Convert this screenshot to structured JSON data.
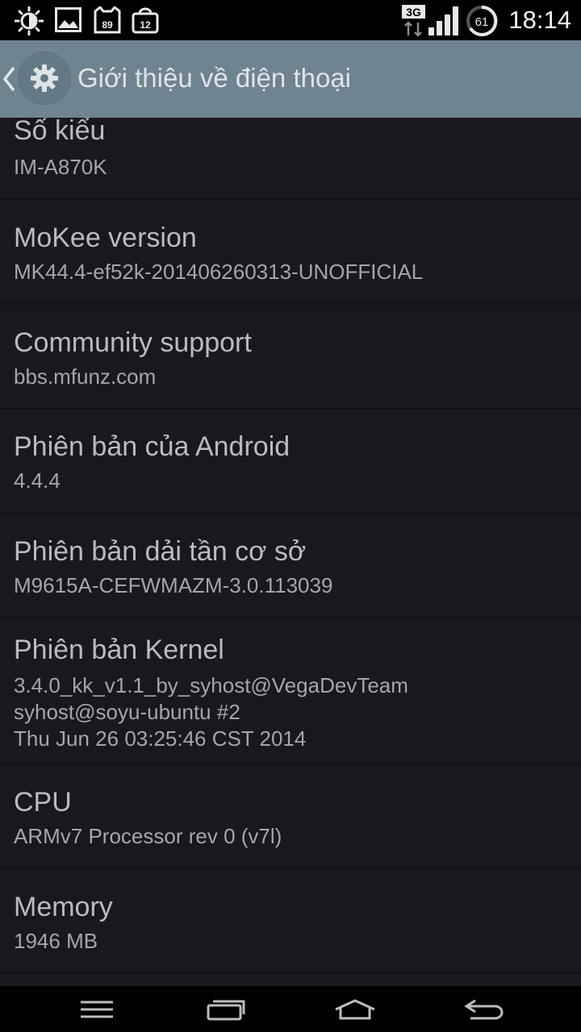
{
  "status_bar": {
    "time": "18:14",
    "network_type": "3G",
    "battery_level": "61",
    "notification_badges": [
      "89",
      "12"
    ],
    "icons": [
      "brightness-icon",
      "gallery-icon",
      "cat-badge-icon",
      "shop-bag-icon",
      "network-3g-icon",
      "signal-icon",
      "battery-icon"
    ]
  },
  "action_bar": {
    "title": "Giới thiệu về điện thoại",
    "back_icon": "chevron-left-icon",
    "app_icon": "gear-icon"
  },
  "items": [
    {
      "title": "Số kiểu",
      "summary": "IM-A870K"
    },
    {
      "title": "MoKee version",
      "summary": "MK44.4-ef52k-201406260313-UNOFFICIAL"
    },
    {
      "title": "Community support",
      "summary": "bbs.mfunz.com"
    },
    {
      "title": "Phiên bản của Android",
      "summary": "4.4.4"
    },
    {
      "title": "Phiên bản dải tần cơ sở",
      "summary": "M9615A-CEFWMAZM-3.0.113039"
    },
    {
      "title": "Phiên bản Kernel",
      "summary": "3.4.0_kk_v1.1_by_syhost@VegaDevTeam\nsyhost@soyu-ubuntu #2\nThu Jun 26 03:25:46 CST 2014"
    },
    {
      "title": "CPU",
      "summary": "ARMv7 Processor rev 0 (v7l)"
    },
    {
      "title": "Memory",
      "summary": "1946 MB"
    }
  ],
  "nav_bar": {
    "buttons": [
      "menu-icon",
      "recent-apps-icon",
      "home-icon",
      "back-icon"
    ]
  },
  "colors": {
    "action_bar": "#6e8490",
    "background": "#17191c",
    "title_text": "#b8bcbf",
    "summary_text": "#a3a7aa"
  }
}
